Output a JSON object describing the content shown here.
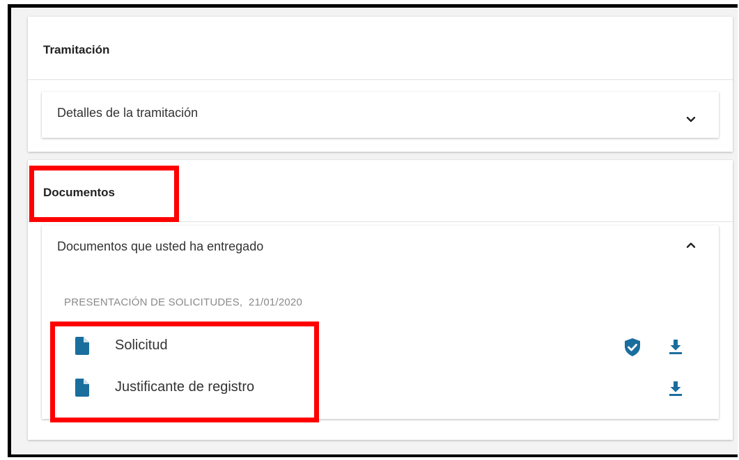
{
  "tramitacion": {
    "title": "Tramitación",
    "panel_label": "Detalles de la tramitación",
    "panel_state": "collapsed"
  },
  "documentos": {
    "title": "Documentos",
    "panel_label": "Documentos que usted ha entregado",
    "panel_state": "expanded",
    "section_caption": "PRESENTACIÓN DE SOLICITUDES,  21/01/2020",
    "files": [
      {
        "name": "Solicitud",
        "icons": [
          "file-icon",
          "verified-shield-icon",
          "download-icon"
        ]
      },
      {
        "name": "Justificante de registro",
        "icons": [
          "file-icon",
          "download-icon"
        ]
      }
    ]
  },
  "colors": {
    "accent": "#1a6e9e",
    "highlight": "#ff0000",
    "background": "#f3f3f3"
  }
}
